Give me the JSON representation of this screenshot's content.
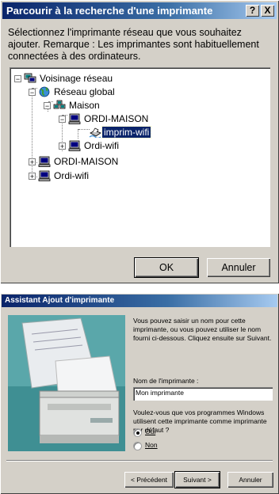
{
  "dialog1": {
    "title": "Parcourir à la recherche d'une imprimante",
    "help_label": "?",
    "close_label": "X",
    "description": "Sélectionnez l'imprimante réseau que vous souhaitez ajouter. Remarque : Les imprimantes sont habituellement connectées à des ordinateurs.",
    "tree": [
      {
        "label": "Voisinage réseau",
        "icon": "network-neighborhood-icon",
        "expander": "−"
      },
      {
        "label": "Réseau global",
        "icon": "globe-icon",
        "expander": "−"
      },
      {
        "label": "Maison",
        "icon": "workgroup-icon",
        "expander": "−"
      },
      {
        "label": "ORDI-MAISON",
        "icon": "computer-icon",
        "expander": "−"
      },
      {
        "label": "imprim-wifi",
        "icon": "printer-icon",
        "selected": true
      },
      {
        "label": "Ordi-wifi",
        "icon": "computer-icon",
        "expander": "+"
      },
      {
        "label": "ORDI-MAISON",
        "icon": "computer-icon",
        "expander": "+"
      },
      {
        "label": "Ordi-wifi",
        "icon": "computer-icon",
        "expander": "+"
      }
    ],
    "ok_label": "OK",
    "cancel_label": "Annuler"
  },
  "dialog2": {
    "title": "Assistant Ajout d'imprimante",
    "intro": "Vous pouvez saisir un nom pour cette imprimante, ou vous pouvez utiliser le nom fourni ci-dessous. Cliquez ensuite sur Suivant.",
    "name_label": "Nom de l'imprimante :",
    "name_value": "Mon imprimante",
    "default_question": "Voulez-vous que vos programmes Windows utilisent cette imprimante comme imprimante par défaut ?",
    "yes_label": "Oui",
    "no_label": "Non",
    "selected": "Oui",
    "back_label": "< Précédent",
    "next_label": "Suivant >",
    "cancel_label": "Annuler"
  }
}
